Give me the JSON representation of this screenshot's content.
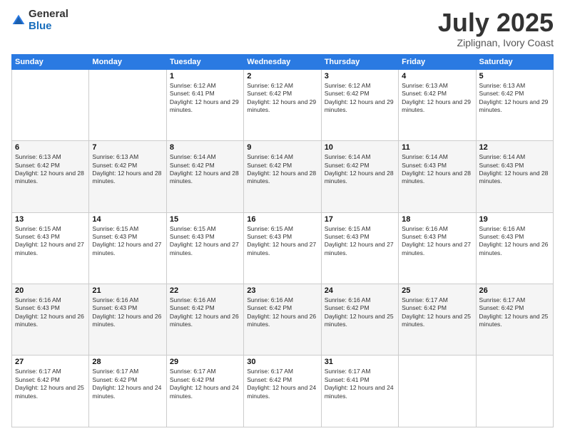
{
  "logo": {
    "general": "General",
    "blue": "Blue"
  },
  "header": {
    "month": "July 2025",
    "location": "Ziplignan, Ivory Coast"
  },
  "weekdays": [
    "Sunday",
    "Monday",
    "Tuesday",
    "Wednesday",
    "Thursday",
    "Friday",
    "Saturday"
  ],
  "weeks": [
    [
      {
        "day": "",
        "info": ""
      },
      {
        "day": "",
        "info": ""
      },
      {
        "day": "1",
        "info": "Sunrise: 6:12 AM\nSunset: 6:41 PM\nDaylight: 12 hours and 29 minutes."
      },
      {
        "day": "2",
        "info": "Sunrise: 6:12 AM\nSunset: 6:42 PM\nDaylight: 12 hours and 29 minutes."
      },
      {
        "day": "3",
        "info": "Sunrise: 6:12 AM\nSunset: 6:42 PM\nDaylight: 12 hours and 29 minutes."
      },
      {
        "day": "4",
        "info": "Sunrise: 6:13 AM\nSunset: 6:42 PM\nDaylight: 12 hours and 29 minutes."
      },
      {
        "day": "5",
        "info": "Sunrise: 6:13 AM\nSunset: 6:42 PM\nDaylight: 12 hours and 29 minutes."
      }
    ],
    [
      {
        "day": "6",
        "info": "Sunrise: 6:13 AM\nSunset: 6:42 PM\nDaylight: 12 hours and 28 minutes."
      },
      {
        "day": "7",
        "info": "Sunrise: 6:13 AM\nSunset: 6:42 PM\nDaylight: 12 hours and 28 minutes."
      },
      {
        "day": "8",
        "info": "Sunrise: 6:14 AM\nSunset: 6:42 PM\nDaylight: 12 hours and 28 minutes."
      },
      {
        "day": "9",
        "info": "Sunrise: 6:14 AM\nSunset: 6:42 PM\nDaylight: 12 hours and 28 minutes."
      },
      {
        "day": "10",
        "info": "Sunrise: 6:14 AM\nSunset: 6:42 PM\nDaylight: 12 hours and 28 minutes."
      },
      {
        "day": "11",
        "info": "Sunrise: 6:14 AM\nSunset: 6:43 PM\nDaylight: 12 hours and 28 minutes."
      },
      {
        "day": "12",
        "info": "Sunrise: 6:14 AM\nSunset: 6:43 PM\nDaylight: 12 hours and 28 minutes."
      }
    ],
    [
      {
        "day": "13",
        "info": "Sunrise: 6:15 AM\nSunset: 6:43 PM\nDaylight: 12 hours and 27 minutes."
      },
      {
        "day": "14",
        "info": "Sunrise: 6:15 AM\nSunset: 6:43 PM\nDaylight: 12 hours and 27 minutes."
      },
      {
        "day": "15",
        "info": "Sunrise: 6:15 AM\nSunset: 6:43 PM\nDaylight: 12 hours and 27 minutes."
      },
      {
        "day": "16",
        "info": "Sunrise: 6:15 AM\nSunset: 6:43 PM\nDaylight: 12 hours and 27 minutes."
      },
      {
        "day": "17",
        "info": "Sunrise: 6:15 AM\nSunset: 6:43 PM\nDaylight: 12 hours and 27 minutes."
      },
      {
        "day": "18",
        "info": "Sunrise: 6:16 AM\nSunset: 6:43 PM\nDaylight: 12 hours and 27 minutes."
      },
      {
        "day": "19",
        "info": "Sunrise: 6:16 AM\nSunset: 6:43 PM\nDaylight: 12 hours and 26 minutes."
      }
    ],
    [
      {
        "day": "20",
        "info": "Sunrise: 6:16 AM\nSunset: 6:43 PM\nDaylight: 12 hours and 26 minutes."
      },
      {
        "day": "21",
        "info": "Sunrise: 6:16 AM\nSunset: 6:43 PM\nDaylight: 12 hours and 26 minutes."
      },
      {
        "day": "22",
        "info": "Sunrise: 6:16 AM\nSunset: 6:42 PM\nDaylight: 12 hours and 26 minutes."
      },
      {
        "day": "23",
        "info": "Sunrise: 6:16 AM\nSunset: 6:42 PM\nDaylight: 12 hours and 26 minutes."
      },
      {
        "day": "24",
        "info": "Sunrise: 6:16 AM\nSunset: 6:42 PM\nDaylight: 12 hours and 25 minutes."
      },
      {
        "day": "25",
        "info": "Sunrise: 6:17 AM\nSunset: 6:42 PM\nDaylight: 12 hours and 25 minutes."
      },
      {
        "day": "26",
        "info": "Sunrise: 6:17 AM\nSunset: 6:42 PM\nDaylight: 12 hours and 25 minutes."
      }
    ],
    [
      {
        "day": "27",
        "info": "Sunrise: 6:17 AM\nSunset: 6:42 PM\nDaylight: 12 hours and 25 minutes."
      },
      {
        "day": "28",
        "info": "Sunrise: 6:17 AM\nSunset: 6:42 PM\nDaylight: 12 hours and 24 minutes."
      },
      {
        "day": "29",
        "info": "Sunrise: 6:17 AM\nSunset: 6:42 PM\nDaylight: 12 hours and 24 minutes."
      },
      {
        "day": "30",
        "info": "Sunrise: 6:17 AM\nSunset: 6:42 PM\nDaylight: 12 hours and 24 minutes."
      },
      {
        "day": "31",
        "info": "Sunrise: 6:17 AM\nSunset: 6:41 PM\nDaylight: 12 hours and 24 minutes."
      },
      {
        "day": "",
        "info": ""
      },
      {
        "day": "",
        "info": ""
      }
    ]
  ]
}
